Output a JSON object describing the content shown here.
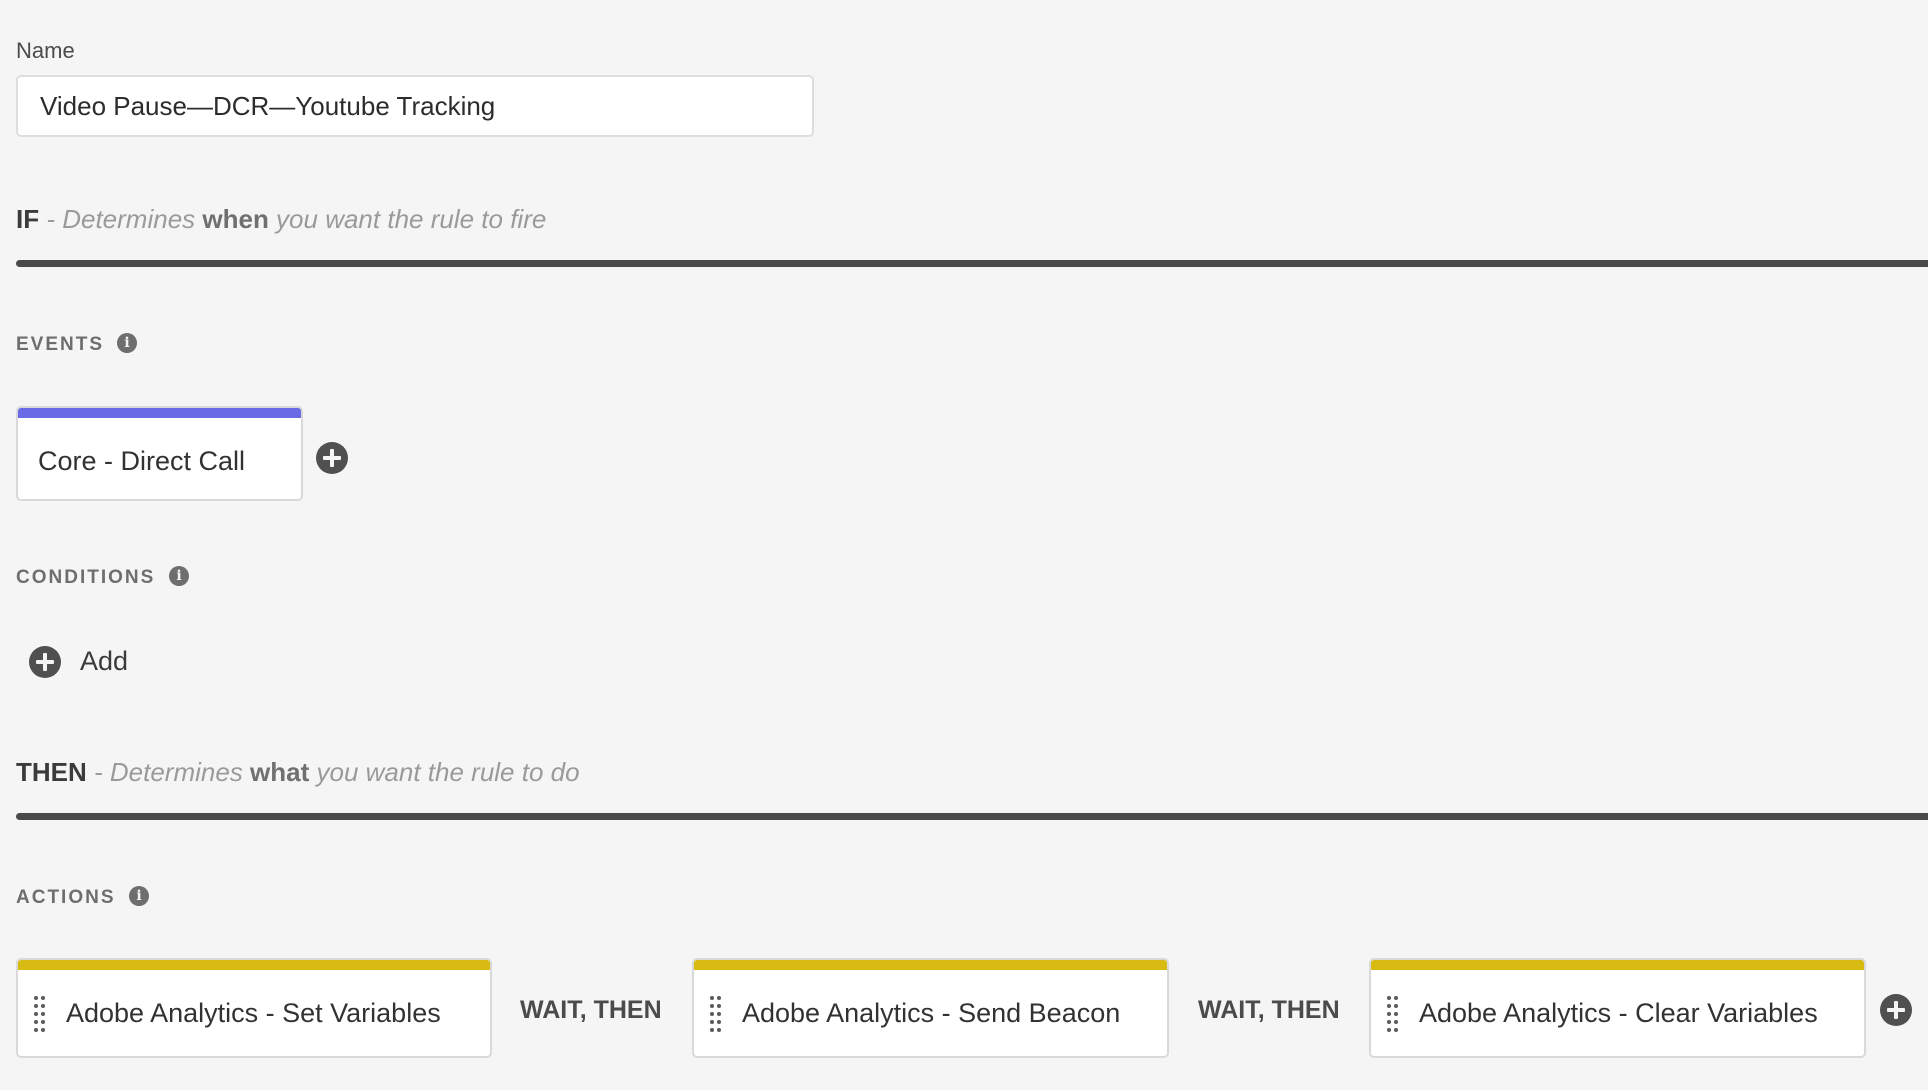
{
  "name_field": {
    "label": "Name",
    "value": "Video Pause—DCR—Youtube Tracking"
  },
  "if_section": {
    "keyword": "IF",
    "desc_prefix": " - Determines ",
    "desc_emphasis": "when",
    "desc_suffix": " you want the rule to fire"
  },
  "events": {
    "label": "EVENTS",
    "items": [
      {
        "title": "Core - Direct Call",
        "bar_color": "#6a6ae6"
      }
    ]
  },
  "conditions": {
    "label": "CONDITIONS",
    "add_label": "Add"
  },
  "then_section": {
    "keyword": "THEN",
    "desc_prefix": " - Determines ",
    "desc_emphasis": "what",
    "desc_suffix": " you want the rule to do"
  },
  "actions": {
    "label": "ACTIONS",
    "bar_color": "#d8bb12",
    "items": [
      {
        "title": "Adobe Analytics - Set Variables"
      },
      {
        "title": "Adobe Analytics - Send Beacon"
      },
      {
        "title": "Adobe Analytics - Clear Variables"
      }
    ],
    "separator_label": "WAIT, THEN"
  },
  "icons": {
    "info": "info-icon",
    "add": "plus-circle-icon",
    "drag": "drag-handle-icon"
  }
}
